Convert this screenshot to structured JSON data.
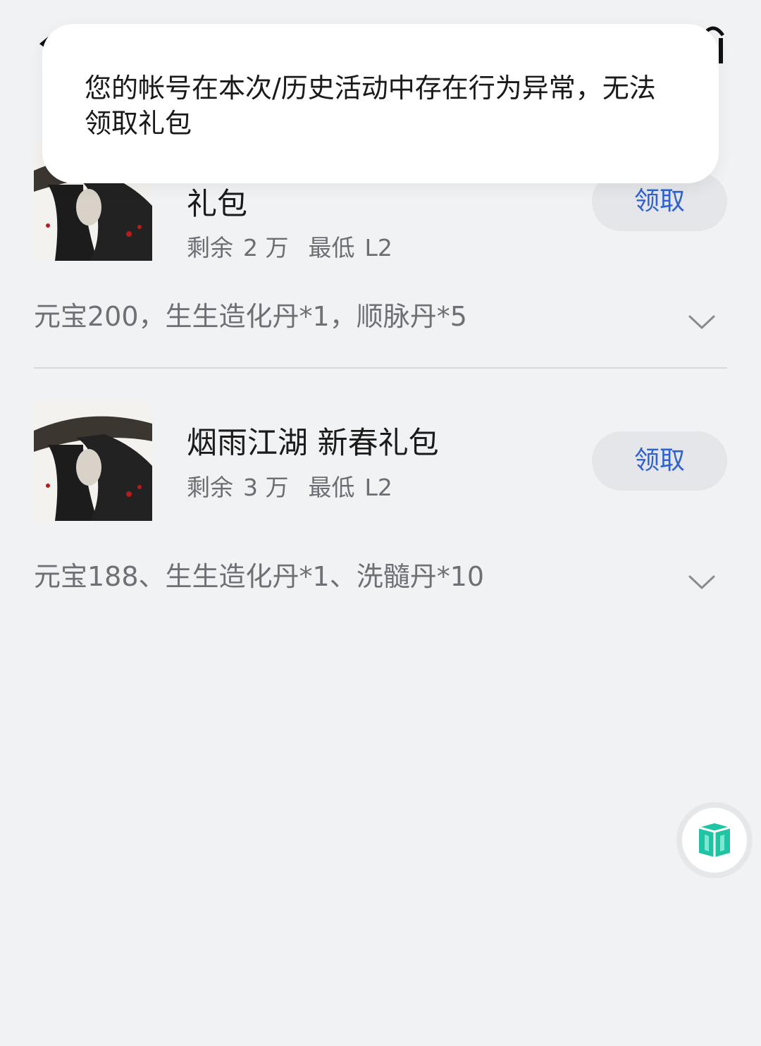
{
  "toast": {
    "message": "您的帐号在本次/历史活动中存在行为异常，无法领取礼包"
  },
  "gifts": [
    {
      "name": "礼包",
      "remaining_label": "剩余",
      "remaining_value": "2 万",
      "min_level_label": "最低",
      "min_level_value": "L2",
      "claim_label": "领取",
      "contents": "元宝200，生生造化丹*1，顺脉丹*5"
    },
    {
      "name": "烟雨江湖  新春礼包",
      "remaining_label": "剩余",
      "remaining_value": "3 万",
      "min_level_label": "最低",
      "min_level_value": "L2",
      "claim_label": "领取",
      "contents": "元宝188、生生造化丹*1、洗髓丹*10"
    }
  ],
  "icons": {
    "back": "back-arrow-icon",
    "top_right": "bag-icon",
    "thumbnail": "swordsman-thumbnail",
    "expand": "chevron-down-icon",
    "assistant": "cube-icon"
  },
  "colors": {
    "background": "#f1f2f4",
    "accent": "#2d62d6",
    "button_bg": "#e4e6e9",
    "assistant_teal": "#1fc4a4"
  }
}
